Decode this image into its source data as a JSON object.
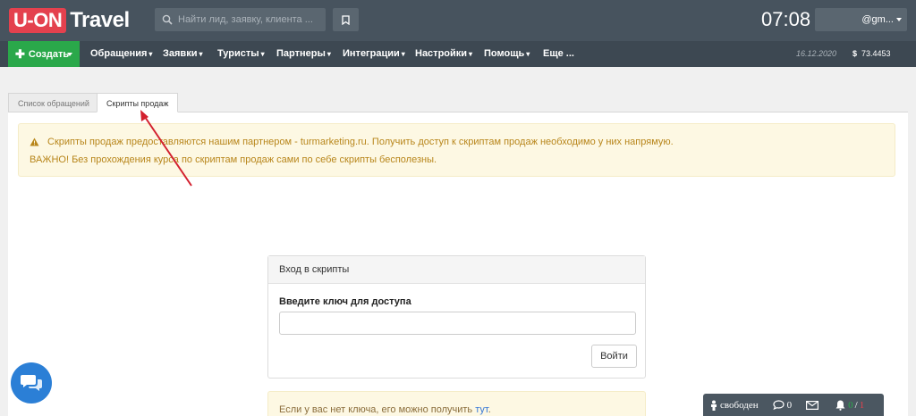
{
  "logo": {
    "badge": "U-ON",
    "text": "Travel"
  },
  "search": {
    "placeholder": "Найти лид, заявку, клиента ..."
  },
  "clock": "07:08",
  "user": {
    "email": "@gm..."
  },
  "navbar": {
    "create_label": "Создать",
    "items": [
      "Обращения",
      "Заявки",
      "Туристы",
      "Партнеры",
      "Интеграции",
      "Настройки",
      "Помощь",
      "Еще ..."
    ],
    "date": "16.12.2020",
    "currency_symbol": "$",
    "rate": "73.4453"
  },
  "tabs": [
    {
      "label": "Список обращений",
      "active": false
    },
    {
      "label": "Скрипты продаж",
      "active": true
    }
  ],
  "alert": {
    "line1": "Скрипты продаж предоставляются нашим партнером - turmarketing.ru. Получить доступ к скриптам продаж необходимо у них напрямую.",
    "line2": "ВАЖНО! Без прохождения курса по скриптам продаж сами по себе скрипты бесполезны."
  },
  "login_card": {
    "title": "Вход в скрипты",
    "label": "Введите ключ для доступа",
    "input_value": "",
    "button_label": "Войти"
  },
  "bottom_alert": {
    "text": "Если у вас нет ключа, его можно получить",
    "link": "тут",
    "suffix": "."
  },
  "status_bar": {
    "status": "свободен",
    "messages": "0",
    "alerts_green": "0",
    "alerts_sep": "/",
    "alerts_red": "1"
  },
  "colors": {
    "topbar": "#47535e",
    "navbar": "#3d4852",
    "create": "#2aa84a",
    "logo_red": "#e4414e",
    "alert_bg": "#fdf8e3",
    "chat": "#2b7fd6"
  }
}
